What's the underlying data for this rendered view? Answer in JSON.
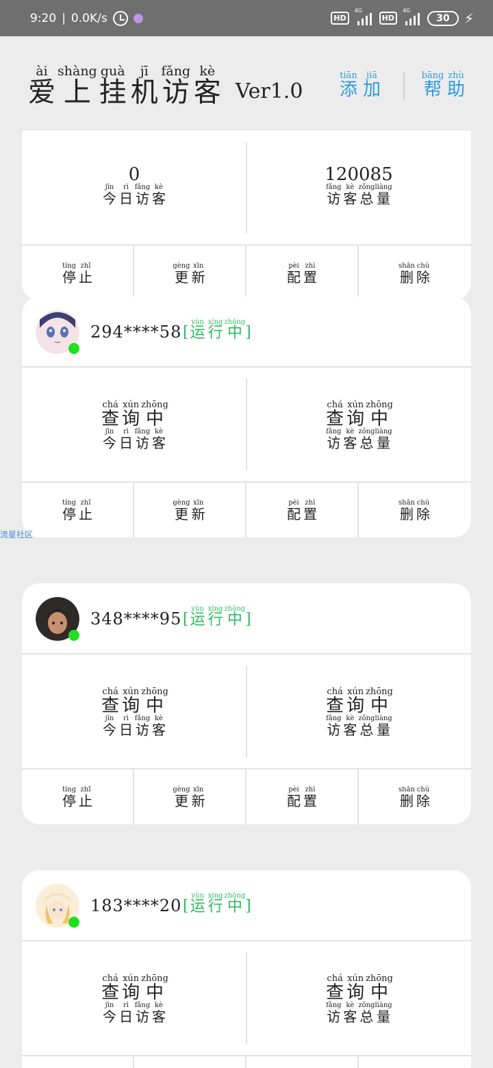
{
  "status_bar": {
    "time": "9:20",
    "net_speed": "0.0K/s",
    "hd1": "HD",
    "hd2": "HD",
    "net_type1": "4G",
    "net_type2": "4G",
    "battery": "30"
  },
  "header": {
    "title": [
      {
        "py": "ài",
        "hz": "爱"
      },
      {
        "py": "shàng",
        "hz": "上"
      },
      {
        "py": "guà",
        "hz": "挂"
      },
      {
        "py": "jī",
        "hz": "机"
      },
      {
        "py": "fǎng",
        "hz": "访"
      },
      {
        "py": "kè",
        "hz": "客"
      }
    ],
    "version": "Ver1.0",
    "add_btn": [
      {
        "py": "tiān",
        "hz": "添"
      },
      {
        "py": "jiā",
        "hz": "加"
      }
    ],
    "help_btn": [
      {
        "py": "bāng",
        "hz": "帮"
      },
      {
        "py": "zhù",
        "hz": "助"
      }
    ]
  },
  "labels": {
    "running": [
      {
        "py": "yùn",
        "hz": "运"
      },
      {
        "py": "xíng",
        "hz": "行"
      },
      {
        "py": "zhōng",
        "hz": "中"
      }
    ],
    "querying": [
      {
        "py": "chá",
        "hz": "查"
      },
      {
        "py": "xún",
        "hz": "询"
      },
      {
        "py": "zhōng",
        "hz": "中"
      }
    ],
    "today_visitors": [
      {
        "py": "jīn",
        "hz": "今"
      },
      {
        "py": "rì",
        "hz": "日"
      },
      {
        "py": "fǎng",
        "hz": "访"
      },
      {
        "py": "kè",
        "hz": "客"
      }
    ],
    "total_visitors": [
      {
        "py": "fǎng",
        "hz": "访"
      },
      {
        "py": "kè",
        "hz": "客"
      },
      {
        "py": "zǒng",
        "hz": "总"
      },
      {
        "py": "liàng",
        "hz": "量"
      }
    ],
    "stop": [
      {
        "py": "tíng",
        "hz": "停"
      },
      {
        "py": "zhǐ",
        "hz": "止"
      }
    ],
    "update": [
      {
        "py": "gèng",
        "hz": "更"
      },
      {
        "py": "xīn",
        "hz": "新"
      }
    ],
    "config": [
      {
        "py": "pèi",
        "hz": "配"
      },
      {
        "py": "zhì",
        "hz": "置"
      }
    ],
    "delete": [
      {
        "py": "shān",
        "hz": "删"
      },
      {
        "py": "chú",
        "hz": "除"
      }
    ]
  },
  "cards": [
    {
      "account": "",
      "today_value": "0",
      "total_value": "120085"
    },
    {
      "account": "294****58"
    },
    {
      "account": "348****95"
    },
    {
      "account": "183****20"
    }
  ],
  "watermark": "流星社区",
  "colors": {
    "accent_blue": "#2b9be0",
    "running_green": "#2dbb5d",
    "online_dot": "#1ee01e"
  }
}
